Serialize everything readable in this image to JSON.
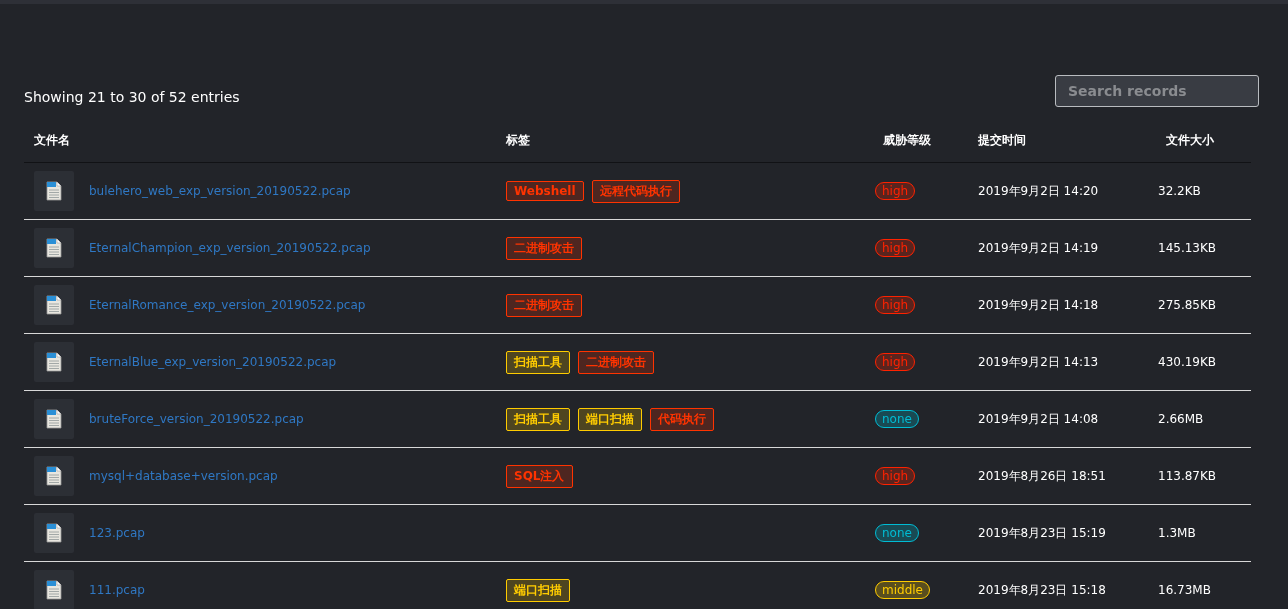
{
  "summary": "Showing 21 to 30 of 52 entries",
  "search": {
    "placeholder": "Search records"
  },
  "table": {
    "columns": [
      "文件名",
      "标签",
      "威胁等级",
      "提交时间",
      "文件大小"
    ],
    "rows": [
      {
        "file": "bulehero_web_exp_version_20190522.pcap",
        "tags": [
          {
            "label": "Webshell",
            "color": "#ff3300"
          },
          {
            "label": "远程代码执行",
            "color": "#ff3300"
          }
        ],
        "level": {
          "label": "high",
          "color": "#ff2200"
        },
        "time": "2019年9月2日 14:20",
        "size": "32.2KB"
      },
      {
        "file": "EternalChampion_exp_version_20190522.pcap",
        "tags": [
          {
            "label": "二进制攻击",
            "color": "#ff3300"
          }
        ],
        "level": {
          "label": "high",
          "color": "#ff2200"
        },
        "time": "2019年9月2日 14:19",
        "size": "145.13KB"
      },
      {
        "file": "EternalRomance_exp_version_20190522.pcap",
        "tags": [
          {
            "label": "二进制攻击",
            "color": "#ff3300"
          }
        ],
        "level": {
          "label": "high",
          "color": "#ff2200"
        },
        "time": "2019年9月2日 14:18",
        "size": "275.85KB"
      },
      {
        "file": "EternalBlue_exp_version_20190522.pcap",
        "tags": [
          {
            "label": "扫描工具",
            "color": "#ffcc00"
          },
          {
            "label": "二进制攻击",
            "color": "#ff3300"
          }
        ],
        "level": {
          "label": "high",
          "color": "#ff2200"
        },
        "time": "2019年9月2日 14:13",
        "size": "430.19KB"
      },
      {
        "file": "bruteForce_version_20190522.pcap",
        "tags": [
          {
            "label": "扫描工具",
            "color": "#ffcc00"
          },
          {
            "label": "端口扫描",
            "color": "#ffcc00"
          },
          {
            "label": "代码执行",
            "color": "#ff3300"
          }
        ],
        "level": {
          "label": "none",
          "color": "#00bcd4"
        },
        "time": "2019年9月2日 14:08",
        "size": "2.66MB"
      },
      {
        "file": "mysql+database+version.pcap",
        "tags": [
          {
            "label": "SQL注入",
            "color": "#ff3300"
          }
        ],
        "level": {
          "label": "high",
          "color": "#ff2200"
        },
        "time": "2019年8月26日 18:51",
        "size": "113.87KB"
      },
      {
        "file": "123.pcap",
        "tags": [],
        "level": {
          "label": "none",
          "color": "#00bcd4"
        },
        "time": "2019年8月23日 15:19",
        "size": "1.3MB"
      },
      {
        "file": "111.pcap",
        "tags": [
          {
            "label": "端口扫描",
            "color": "#ffcc00"
          }
        ],
        "level": {
          "label": "middle",
          "color": "#ffcc00"
        },
        "time": "2019年8月23日 15:18",
        "size": "16.73MB"
      }
    ]
  }
}
